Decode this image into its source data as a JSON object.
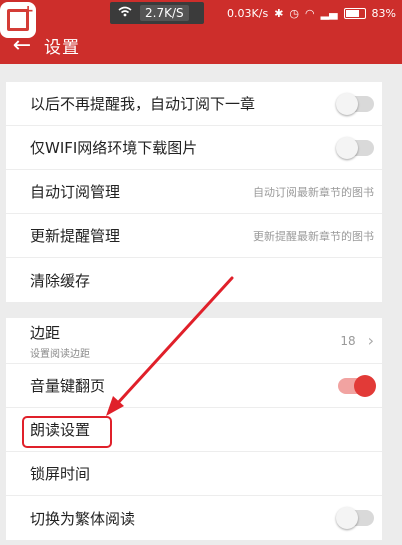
{
  "status_bar": {
    "network_speed": "2.7K/S",
    "data_rate": "0.03K/s",
    "battery": "83%",
    "battery_level": 0.83
  },
  "app_bar": {
    "title": "设置"
  },
  "settings_group_1": [
    {
      "label": "以后不再提醒我，自动订阅下一章",
      "control": "toggle",
      "on": false
    },
    {
      "label": "仅WIFI网络环境下载图片",
      "control": "toggle",
      "on": false
    },
    {
      "label": "自动订阅管理",
      "hint": "自动订阅最新章节的图书"
    },
    {
      "label": "更新提醒管理",
      "hint": "更新提醒最新章节的图书"
    },
    {
      "label": "清除缓存"
    }
  ],
  "settings_group_2": {
    "margin": {
      "label": "边距",
      "sublabel": "设置阅读边距",
      "value": "18"
    },
    "volume_key": {
      "label": "音量键翻页",
      "on": true
    },
    "read_aloud": {
      "label": "朗读设置"
    },
    "lock_time": {
      "label": "锁屏时间"
    },
    "traditional": {
      "label": "切换为繁体阅读",
      "on": false
    }
  },
  "colors": {
    "brand": "#cd2e2b",
    "annotation": "#e0202a",
    "toggle_on": "#e23a37"
  }
}
